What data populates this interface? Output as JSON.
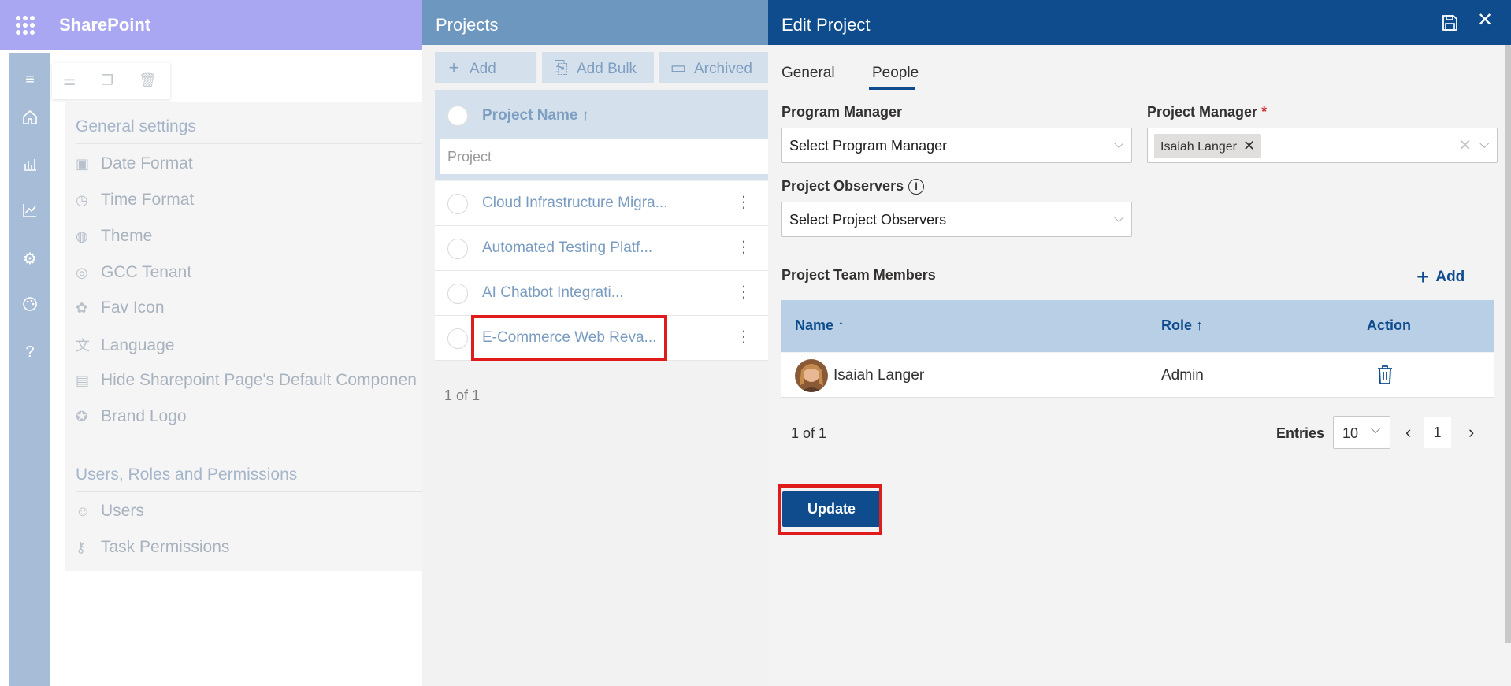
{
  "suitebar": {
    "brand": "SharePoint"
  },
  "settings": {
    "general_title": "General settings",
    "general_items": [
      {
        "label": "Date Format",
        "icon": "calendar-clock-icon"
      },
      {
        "label": "Time Format",
        "icon": "stopwatch-icon"
      },
      {
        "label": "Theme",
        "icon": "palette-icon"
      },
      {
        "label": "GCC Tenant",
        "icon": "globe-icon"
      },
      {
        "label": "Fav Icon",
        "icon": "fav-icon"
      },
      {
        "label": "Language",
        "icon": "language-icon"
      },
      {
        "label": "Hide Sharepoint Page's Default Componen",
        "icon": "window-icon"
      },
      {
        "label": "Brand Logo",
        "icon": "badge-icon"
      }
    ],
    "users_title": "Users, Roles and Permissions",
    "users_items": [
      {
        "label": "Users",
        "icon": "people-icon"
      },
      {
        "label": "Task Permissions",
        "icon": "key-icon"
      }
    ]
  },
  "projects": {
    "title": "Projects",
    "toolbar": {
      "add": "Add",
      "add_bulk": "Add Bulk",
      "archived": "Archived"
    },
    "column_header": "Project Name ↑",
    "filter_placeholder": "Project",
    "rows": [
      "Cloud Infrastructure Migra...",
      "Automated Testing Platf...",
      "AI Chatbot Integrati...",
      "E-Commerce Web Reva..."
    ],
    "page_info": "1 of 1"
  },
  "edit_project": {
    "title": "Edit Project",
    "tabs": [
      "General",
      "People"
    ],
    "active_tab": "People",
    "program_manager": {
      "label": "Program Manager",
      "placeholder": "Select Program Manager"
    },
    "project_manager": {
      "label": "Project Manager",
      "required_mark": "*",
      "selected": "Isaiah Langer"
    },
    "project_observers": {
      "label": "Project Observers",
      "placeholder": "Select Project Observers"
    },
    "team_members": {
      "label": "Project Team Members",
      "add_label": "Add",
      "columns": {
        "name": "Name ↑",
        "role": "Role ↑",
        "action": "Action"
      },
      "rows": [
        {
          "name": "Isaiah Langer",
          "role": "Admin"
        }
      ],
      "page_info": "1 of 1",
      "entries_label": "Entries",
      "entries_value": "10",
      "current_page": "1"
    },
    "update_label": "Update"
  },
  "colors": {
    "suitebar": "#a9a7f2",
    "panel_header": "#0f4c8e",
    "projects_header": "#6e97bf",
    "highlight": "#e01b1b"
  }
}
